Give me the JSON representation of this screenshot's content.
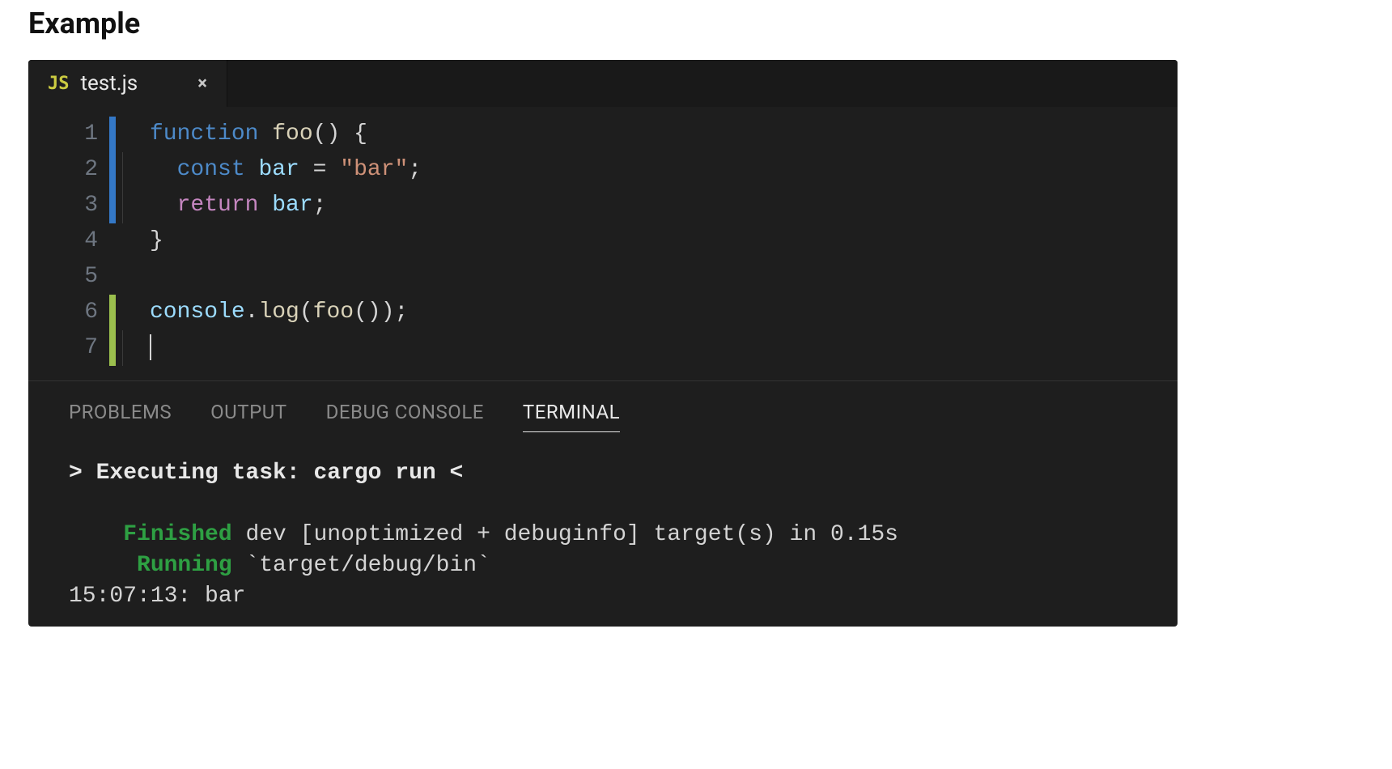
{
  "heading": "Example",
  "tab": {
    "icon_label": "JS",
    "filename": "test.js"
  },
  "code": {
    "line_numbers": [
      "1",
      "2",
      "3",
      "4",
      "5",
      "6",
      "7"
    ],
    "tokens": {
      "l1": {
        "kw": "function",
        "fn": "foo",
        "rest": "() {"
      },
      "l2": {
        "kw": "const",
        "var": "bar",
        "eq": " = ",
        "str": "\"bar\"",
        "semi": ";"
      },
      "l3": {
        "ret": "return",
        "sp": " ",
        "var": "bar",
        "semi": ";"
      },
      "l4": {
        "text": "}"
      },
      "l6": {
        "obj": "console",
        "dot": ".",
        "method": "log",
        "call1": "(",
        "fn": "foo",
        "call2": "());"
      }
    }
  },
  "panel": {
    "tabs": {
      "problems": "PROBLEMS",
      "output": "OUTPUT",
      "debug_console": "DEBUG CONSOLE",
      "terminal": "TERMINAL"
    },
    "terminal": {
      "exec_line": "> Executing task: cargo run <",
      "finished_label": "Finished",
      "finished_rest": " dev [unoptimized + debuginfo] target(s) in 0.15s",
      "running_label": "Running",
      "running_rest": " `target/debug/bin`",
      "output_line": "15:07:13: bar"
    }
  }
}
